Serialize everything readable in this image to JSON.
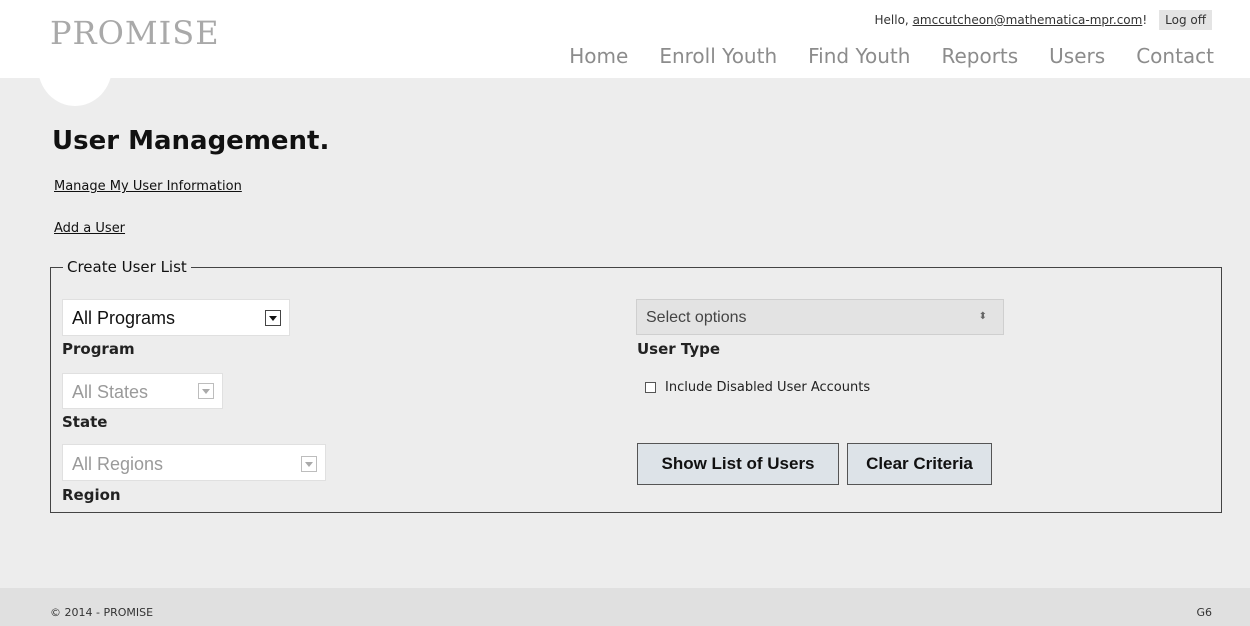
{
  "header": {
    "logo": "PROMISE",
    "greeting": "Hello,",
    "user_email": "amccutcheon@mathematica-mpr.com",
    "greeting_end": "!",
    "logoff_label": "Log off",
    "nav": [
      "Home",
      "Enroll Youth",
      "Find Youth",
      "Reports",
      "Users",
      "Contact"
    ]
  },
  "main": {
    "title": "User Management.",
    "manage_link": "Manage My User Information",
    "add_link": "Add a User",
    "criteria": {
      "legend": "Create User List",
      "program": {
        "value": "All Programs",
        "label": "Program"
      },
      "state": {
        "value": "All States",
        "label": "State"
      },
      "region": {
        "value": "All Regions",
        "label": "Region"
      },
      "user_type": {
        "value": "Select options",
        "label": "User Type"
      },
      "include_disabled_label": "Include Disabled User Accounts",
      "include_disabled_checked": false,
      "show_button": "Show List of Users",
      "clear_button": "Clear Criteria"
    }
  },
  "footer": {
    "copyright": "© 2014 - PROMISE",
    "code": "G6"
  },
  "colors": {
    "main_bg": "#ededed",
    "footer_bg": "#e0e0e0",
    "nav_text": "#8c8c8c",
    "button_bg": "#dde3e8"
  }
}
